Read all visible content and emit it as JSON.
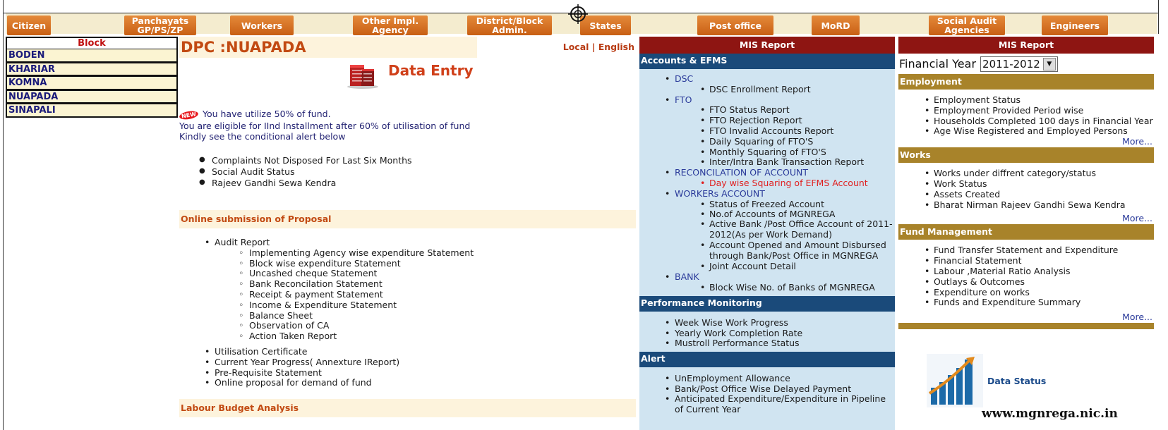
{
  "nav": {
    "items": [
      {
        "label": "Citizen"
      },
      {
        "label": "Panchayats GP/PS/ZP"
      },
      {
        "label": "Workers"
      },
      {
        "label": "Other Impl. Agency"
      },
      {
        "label": "District/Block Admin."
      },
      {
        "label": "States"
      },
      {
        "label": "Post office"
      },
      {
        "label": "MoRD"
      },
      {
        "label": "Social Audit Agencies"
      },
      {
        "label": "Engineers"
      }
    ],
    "accent": "#d0701f"
  },
  "block": {
    "header": "Block",
    "items": [
      "BODEN",
      "KHARIAR",
      "KOMNA",
      "NUAPADA",
      "SINAPALI"
    ]
  },
  "center": {
    "title": "DPC :NUAPADA",
    "lang": "Local | English",
    "data_entry": "Data Entry",
    "new_badge": "NEW",
    "msg1": "You have utilize 50% of fund.",
    "msg2": "You are eligible for IInd Installment after 60% of utilisation of fund",
    "msg3": "Kindly see the conditional alert below",
    "alerts": [
      "Complaints Not Disposed For Last Six Months",
      "Social Audit Status",
      "Rajeev Gandhi Sewa Kendra"
    ],
    "online_header": "Online submission of Proposal",
    "audit_report": "Audit Report",
    "audit_sub": [
      "Implementing Agency wise expenditure Statement",
      "Block wise expenditure Statement",
      "Uncashed cheque Statement",
      "Bank Reconcilation Statement",
      "Receipt & payment Statement",
      "Income & Expenditure Statement",
      "Balance Sheet",
      "Observation of CA",
      "Action Taken Report"
    ],
    "other_items": [
      "Utilisation Certificate",
      "Current Year Progress( Annexture IReport)",
      "Pre-Requisite Statement",
      "Online proposal for demand of fund"
    ],
    "labour_header": "Labour Budget Analysis"
  },
  "mis_mid": {
    "head": "MIS Report",
    "accounts_header": "Accounts & EFMS",
    "dsc": "DSC",
    "dsc_sub": [
      "DSC Enrollment Report"
    ],
    "fto": "FTO",
    "fto_sub": [
      "FTO Status Report",
      "FTO Rejection Report",
      "FTO Invalid Accounts Report",
      "Daily Squaring of FTO'S",
      "Monthly Squaring of FTO'S",
      "Inter/Intra Bank Transaction Report"
    ],
    "recon": "RECONCILATION OF ACCOUNT",
    "recon_sub": "Day wise Squaring of EFMS Account",
    "workers": "WORKERs ACCOUNT",
    "workers_sub": [
      "Status of Freezed Account",
      "No.of Accounts of MGNREGA",
      "Active Bank /Post Office Account of 2011-2012(As per Work Demand)",
      "Account Opened and Amount Disbursed through Bank/Post Office in MGNREGA",
      "Joint Account Detail"
    ],
    "bank": "BANK",
    "bank_sub": [
      "Block Wise No. of Banks of MGNREGA"
    ],
    "perf_header": "Performance Monitoring",
    "perf_items": [
      "Week Wise Work Progress",
      "Yearly Work Completion Rate",
      "Mustroll Performance Status"
    ],
    "alert_header": "Alert",
    "alert_items": [
      "UnEmployment Allowance",
      "Bank/Post Office Wise Delayed Payment",
      "Anticipated Expenditure/Expenditure in Pipeline of Current Year"
    ]
  },
  "mis_right": {
    "head": "MIS Report",
    "fy_label": "Financial Year",
    "fy_value": "2011-2012",
    "employment_header": "Employment",
    "employment_items": [
      "Employment Status",
      "Employment Provided Period wise",
      "Households Completed 100 days in Financial Year",
      "Age Wise Registered and Employed Persons"
    ],
    "works_header": "Works",
    "works_items": [
      "Works under diffrent category/status",
      "Work Status",
      "Assets Created",
      "Bharat Nirman Rajeev Gandhi Sewa Kendra"
    ],
    "fund_header": "Fund Management",
    "fund_items": [
      "Fund Transfer Statement and Expenditure",
      "Financial Statement",
      "Labour ,Material Ratio Analysis",
      "Outlays & Outcomes",
      "Expenditure on works",
      "Funds and Expenditure Summary"
    ],
    "more": "More...",
    "data_status": "Data Status",
    "site": "www.mgnrega.nic.in"
  }
}
